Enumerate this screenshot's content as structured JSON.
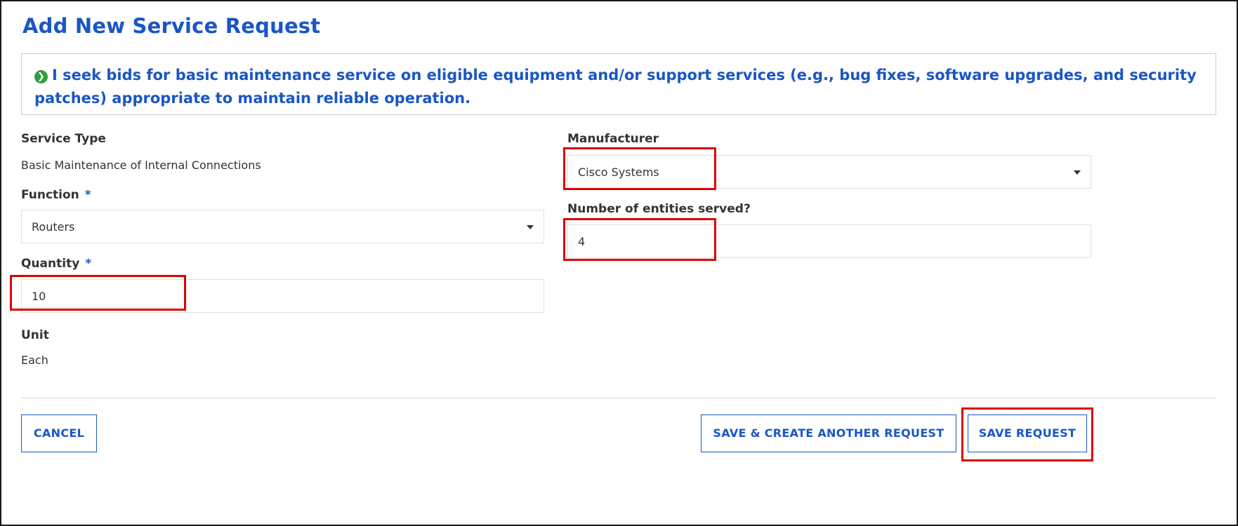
{
  "page": {
    "title": "Add New Service Request"
  },
  "info": {
    "icon": "chevron-right-circle-icon",
    "text": "I seek bids for basic maintenance service on eligible equipment and/or support services (e.g., bug fixes, software upgrades, and security patches) appropriate to maintain reliable operation."
  },
  "form": {
    "service_type": {
      "label": "Service Type",
      "value": "Basic Maintenance of Internal Connections"
    },
    "function": {
      "label": "Function",
      "required_marker": "*",
      "value": "Routers"
    },
    "quantity": {
      "label": "Quantity",
      "required_marker": "*",
      "value": "10"
    },
    "unit": {
      "label": "Unit",
      "value": "Each"
    },
    "manufacturer": {
      "label": "Manufacturer",
      "value": "Cisco Systems"
    },
    "entities": {
      "label": "Number of entities served?",
      "value": "4"
    }
  },
  "actions": {
    "cancel_label": "CANCEL",
    "save_create_label": "SAVE & CREATE ANOTHER REQUEST",
    "save_label": "SAVE REQUEST"
  },
  "colors": {
    "accent": "#1a56c4",
    "highlight": "#e00000",
    "info_icon": "#2e9e3f"
  }
}
